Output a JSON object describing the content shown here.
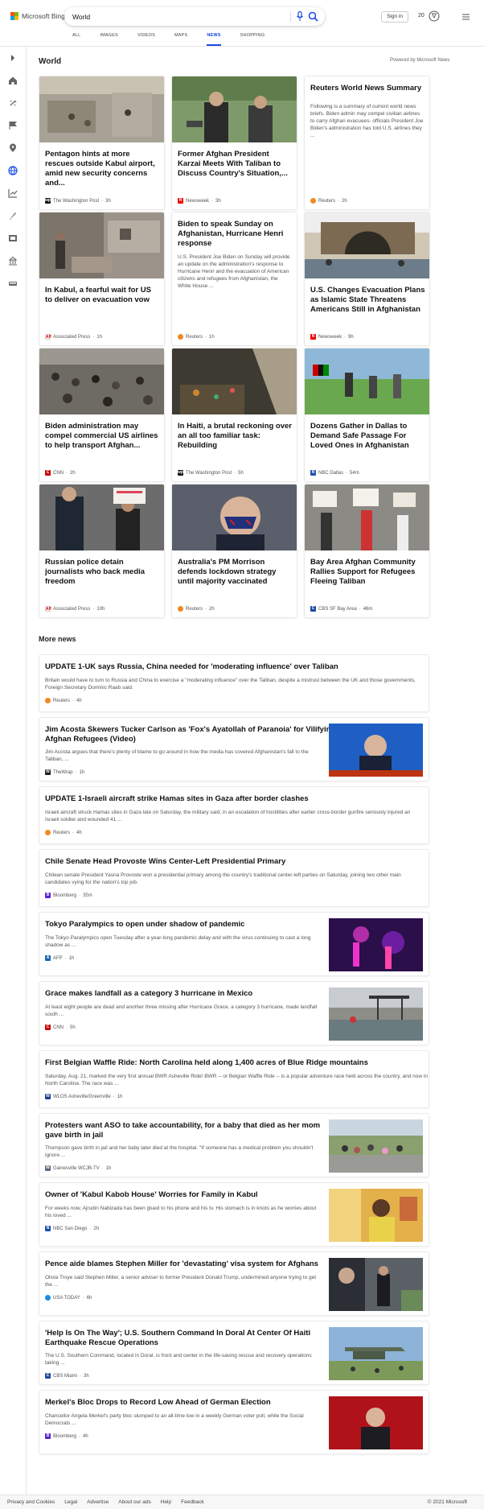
{
  "header": {
    "logo_text": "Microsoft Bing",
    "search_value": "World",
    "signin_label": "Sign in",
    "rewards_count": "20"
  },
  "tabs": [
    {
      "label": "ALL"
    },
    {
      "label": "IMAGES"
    },
    {
      "label": "VIDEOS"
    },
    {
      "label": "MAPS"
    },
    {
      "label": "NEWS"
    },
    {
      "label": "SHOPPING"
    }
  ],
  "sidebar": {
    "icons": [
      "chevron-right-icon",
      "home-icon",
      "sparkle-icon",
      "flag-icon",
      "location-icon",
      "globe-icon",
      "chart-icon",
      "rocket-icon",
      "film-icon",
      "building-icon",
      "car-icon"
    ]
  },
  "world": {
    "title": "World",
    "powered_by": "Powered by Microsoft News",
    "cards": [
      {
        "title": "Pentagon hints at more rescues outside Kabul airport, amid new security concerns and...",
        "desc": "",
        "source": "The Washington Post",
        "time": "3h"
      },
      {
        "title": "Former Afghan President Karzai Meets With Taliban to Discuss Country's Situation,...",
        "desc": "",
        "source": "Newsweek",
        "time": "3h"
      },
      {
        "title": "Reuters World News Summary",
        "desc": "Following is a summary of current world news briefs. Biden admin may compel civilian airlines to carry Afghan evacuees- officials President Joe Biden's administration has told U.S. airlines they ...",
        "source": "Reuters",
        "time": "2h"
      },
      {
        "title": "In Kabul, a fearful wait for US to deliver on evacuation vow",
        "desc": "",
        "source": "Associated Press",
        "time": "1h"
      },
      {
        "title": "Biden to speak Sunday on Afghanistan, Hurricane Henri response",
        "desc": "U.S. President Joe Biden on Sunday will provide an update on the administration's response to Hurricane Henri and the evacuation of American citizens and refugees from Afghanistan, the White House ...",
        "source": "Reuters",
        "time": "1h"
      },
      {
        "title": "U.S. Changes Evacuation Plans as Islamic State Threatens Americans Still in Afghanistan",
        "desc": "",
        "source": "Newsweek",
        "time": "9h"
      },
      {
        "title": "Biden administration may compel commercial US airlines to help transport Afghan...",
        "desc": "",
        "source": "CNN",
        "time": "2h"
      },
      {
        "title": "In Haiti, a brutal reckoning over an all too familiar task: Rebuilding",
        "desc": "",
        "source": "The Washington Post",
        "time": "5h"
      },
      {
        "title": "Dozens Gather in Dallas to Demand Safe Passage For Loved Ones in Afghanistan",
        "desc": "",
        "source": "NBC Dallas",
        "time": "54m"
      },
      {
        "title": "Russian police detain journalists who back media freedom",
        "desc": "",
        "source": "Associated Press",
        "time": "10h"
      },
      {
        "title": "Australia's PM Morrison defends lockdown strategy until majority vaccinated",
        "desc": "",
        "source": "Reuters",
        "time": "2h"
      },
      {
        "title": "Bay Area Afghan Community Rallies Support for Refugees Fleeing Taliban",
        "desc": "",
        "source": "CBS SF Bay Area",
        "time": "46m"
      }
    ]
  },
  "more_news": {
    "title": "More news",
    "items": [
      {
        "title": "UPDATE 1-UK says Russia, China needed for 'moderating influence' over Taliban",
        "desc1": "Britain would have to turn to Russia and China to exercise a \"moderating influence\" over the Taliban, despite a mistrust between the UK and those governments,",
        "desc2": "Foreign Secretary Dominic Raab said.",
        "source": "Reuters",
        "time": "4h"
      },
      {
        "title": "Jim Acosta Skewers Tucker Carlson as 'Fox's Ayatollah of Paranoia' for Vilifying",
        "title2": "Afghan Refugees (Video)",
        "desc1": "Jim Acosta argues that there's plenty of blame to go around in how the media has covered Afghanistan's fall to the",
        "desc2": "Taliban, ...",
        "source": "TheWrap",
        "time": "1h"
      },
      {
        "title": "UPDATE 1-Israeli aircraft strike Hamas sites in Gaza after border clashes",
        "desc1": "Israeli aircraft struck Hamas sites in Gaza late on Saturday, the military said, in an escalation of hostilities after earlier cross-border gunfire seriously injured an",
        "desc2": "Israeli soldier and wounded 41 ...",
        "source": "Reuters",
        "time": "4h"
      },
      {
        "title": "Chile Senate Head Provoste Wins Center-Left Presidential Primary",
        "desc1": "Chilean senate President Yasna Provoste won a presidential primary among the country's traditional center-left parties on Saturday, joining two other main",
        "desc2": "candidates vying for the nation's top job.",
        "source": "Bloomberg",
        "time": "35m"
      },
      {
        "title": "Tokyo Paralympics to open under shadow of pandemic",
        "desc1": "The Tokyo Paralympics open Tuesday after a year-long pandemic delay and with the virus continuing to cast a long",
        "desc2": "shadow as ...",
        "source": "AFP",
        "time": "1h"
      },
      {
        "title": "Grace makes landfall as a category 3 hurricane in Mexico",
        "desc1": "At least eight people are dead and another three missing after Hurricane Grace, a category 3 hurricane, made landfall",
        "desc2": "south ...",
        "source": "CNN",
        "time": "5h"
      },
      {
        "title": "First Belgian Waffle Ride: North Carolina held along 1,400 acres of Blue Ridge mountains",
        "desc1": "Saturday, Aug. 21, marked the very first annual BWR Asheville Ride! BWR -- or Belgian Waffle Ride -- is a popular adventure race held across the country, and now in",
        "desc2": "North Carolina. The race was ...",
        "source": "WLOS Asheville/Greenville",
        "time": "1h"
      },
      {
        "title": "Protesters want ASO to take accountability, for a baby that died as her mom",
        "title2": "gave birth in jail",
        "desc1": "Thompson gave birth in jail and her baby later died at the hospital. \"If someone has a medical problem you shouldn't",
        "desc2": "ignore ...",
        "source": "Gainesville WCJB-TV",
        "time": "1h"
      },
      {
        "title": "Owner of 'Kabul Kabob House' Worries for Family in Kabul",
        "desc1": "For weeks now, Ajrudin Nabizada has been glued to his phone and his tv. His stomach is in knots as he worries about",
        "desc2": "his loved ...",
        "source": "NBC San Diego",
        "time": "2h"
      },
      {
        "title": "Pence aide blames Stephen Miller for 'devastating' visa system for Afghans",
        "desc1": "Olivia Troye said Stephen Miller, a senior adviser to former President Donald Trump, undermined anyone trying to get",
        "desc2": "the ...",
        "source": "USA TODAY",
        "time": "6h"
      },
      {
        "title": "'Help Is On The Way'; U.S. Southern Command In Doral At Center Of Haiti",
        "title2": "Earthquake Rescue Operations",
        "desc1": "The U.S. Southern Command, located in Doral, is front and center in the life-saving rescue and recovery operations",
        "desc2": "taking ...",
        "source": "CBS Miami",
        "time": "3h"
      },
      {
        "title": "Merkel's Bloc Drops to Record Low Ahead of German Election",
        "desc1": "Chancellor Angela Merkel's party bloc slumped to an all-time low in a weekly German voter poll, while the Social",
        "desc2": "Democrats ...",
        "source": "Bloomberg",
        "time": "4h"
      }
    ]
  },
  "footer": {
    "links": [
      "Privacy and Cookies",
      "Legal",
      "Advertise",
      "About our ads",
      "Help",
      "Feedback"
    ],
    "copyright": "© 2021 Microsoft"
  }
}
